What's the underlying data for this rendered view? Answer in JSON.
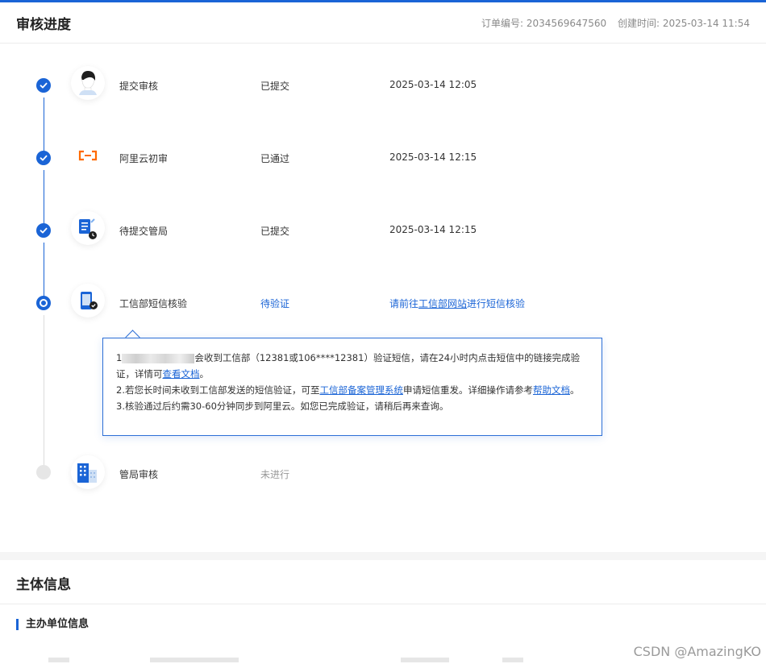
{
  "progress_panel": {
    "title": "审核进度",
    "order_no": "订单编号: 2034569647560",
    "created_time": "创建时间: 2025-03-14 11:54"
  },
  "steps": [
    {
      "name": "提交审核",
      "status": "已提交",
      "time": "2025-03-14 12:05",
      "icon": "user-avatar-icon",
      "state": "done"
    },
    {
      "name": "阿里云初审",
      "status": "已通过",
      "time": "2025-03-14 12:15",
      "icon": "aliyun-logo-icon",
      "state": "done"
    },
    {
      "name": "待提交管局",
      "status": "已提交",
      "time": "2025-03-14 12:15",
      "icon": "document-clock-icon",
      "state": "done"
    },
    {
      "name": "工信部短信核验",
      "status": "待验证",
      "icon": "phone-verify-icon",
      "state": "current",
      "link_prefix": "请前往",
      "link_text": "工信部网站",
      "link_suffix": "进行短信核验"
    },
    {
      "name": "管局审核",
      "status": "未进行",
      "icon": "building-icon",
      "state": "todo"
    }
  ],
  "tooltip": {
    "line1_prefix": "1",
    "line1_main": "会收到工信部（12381或106****12381）验证短信，请在24小时内点击短信中的链接完成验证，详情可",
    "line1_link": "查看文档",
    "line1_end": "。",
    "line2_prefix": "2.若您长时间未收到工信部发送的短信验证，可至",
    "line2_link1": "工信部备案管理系统",
    "line2_mid": "申请短信重发。详细操作请参考",
    "line2_link2": "帮助文档",
    "line2_end": "。",
    "line3": "3.核验通过后约需30-60分钟同步到阿里云。如您已完成验证，请稍后再来查询。"
  },
  "entity_panel": {
    "title": "主体信息",
    "section": "主办单位信息"
  },
  "watermark": "CSDN @AmazingKO",
  "colors": {
    "accent": "#1a64d6",
    "aliyun_orange": "#ff6a00",
    "muted": "#999999"
  }
}
